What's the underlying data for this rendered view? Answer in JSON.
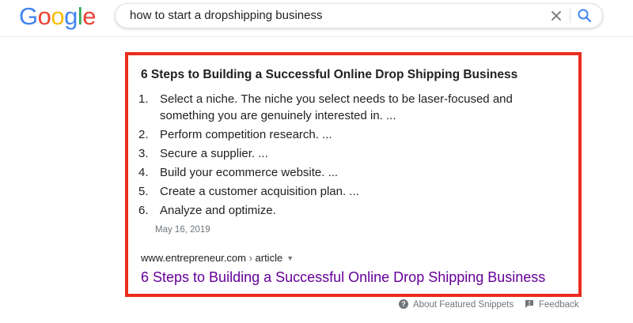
{
  "header": {
    "logo_letters": [
      {
        "char": "G",
        "color": "#4285f4"
      },
      {
        "char": "o",
        "color": "#ea4335"
      },
      {
        "char": "o",
        "color": "#fbbc05"
      },
      {
        "char": "g",
        "color": "#4285f4"
      },
      {
        "char": "l",
        "color": "#34a853"
      },
      {
        "char": "e",
        "color": "#ea4335"
      }
    ],
    "search": {
      "query": "how to start a dropshipping business",
      "clear_icon": "close-icon",
      "search_icon": "search-icon",
      "search_icon_color": "#4285f4"
    }
  },
  "snippet": {
    "highlight_color": "#ea2c1c",
    "title": "6 Steps to Building a Successful Online Drop Shipping Business",
    "steps": [
      {
        "num": "1.",
        "text": "Select a niche. The niche you select needs to be laser-focused and something you are genuinely interested in. ..."
      },
      {
        "num": "2.",
        "text": "Perform competition research. ..."
      },
      {
        "num": "3.",
        "text": "Secure a supplier. ..."
      },
      {
        "num": "4.",
        "text": "Build your ecommerce website. ..."
      },
      {
        "num": "5.",
        "text": "Create a customer acquisition plan. ..."
      },
      {
        "num": "6.",
        "text": "Analyze and optimize."
      }
    ],
    "date": "May 16, 2019",
    "source_domain": "www.entrepreneur.com",
    "source_sep": " › ",
    "source_path": "article",
    "link_text": "6 Steps to Building a Successful Online Drop Shipping Business",
    "link_color": "#660099"
  },
  "footer": {
    "about": "About Featured Snippets",
    "about_icon": "help-icon",
    "feedback": "Feedback",
    "feedback_icon": "feedback-icon"
  }
}
